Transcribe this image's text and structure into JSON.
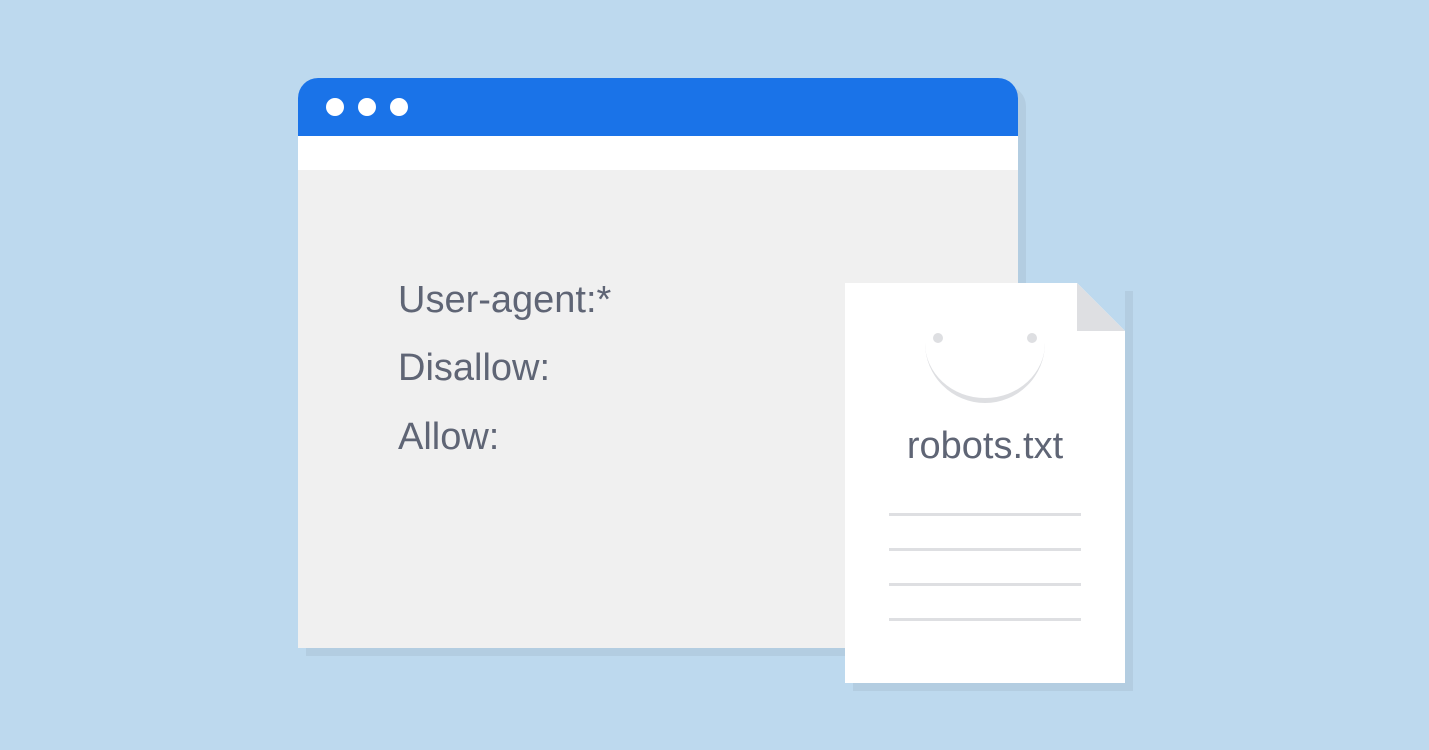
{
  "browser": {
    "content": {
      "line1": "User-agent:*",
      "line2": "Disallow:",
      "line3": "Allow:"
    }
  },
  "file": {
    "title": "robots.txt"
  }
}
